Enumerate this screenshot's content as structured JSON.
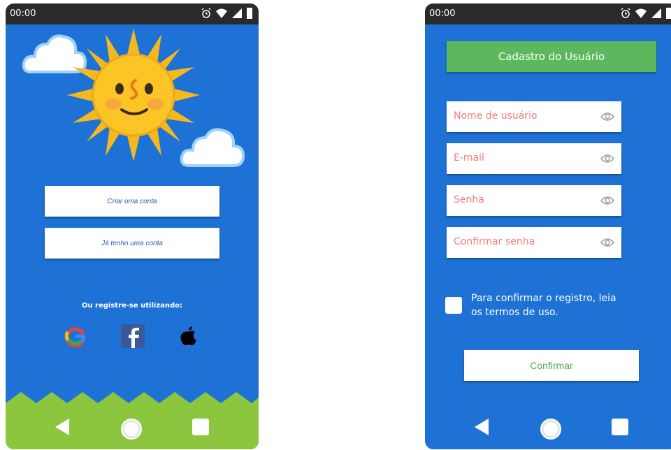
{
  "left_screen": {
    "status_time": "00:00",
    "create_account_label": "Criar uma conta",
    "have_account_label": "Já tenho uma conta",
    "register_with_label": "Ou registre-se utilizando:",
    "social_icons": [
      "google-icon",
      "facebook-icon",
      "apple-icon"
    ],
    "background_color": "#1e72d6",
    "grass_color": "#8cc63f"
  },
  "right_screen": {
    "status_time": "00:00",
    "header_label": "Cadastro do Usuário",
    "fields": [
      {
        "placeholder": "Nome de usuário",
        "icon": "eye-icon"
      },
      {
        "placeholder": "E-mail",
        "icon": "eye-icon"
      },
      {
        "placeholder": "Senha",
        "icon": "eye-icon"
      },
      {
        "placeholder": "Confirmar senha",
        "icon": "eye-icon"
      }
    ],
    "terms_line1": "Para confirmar o registro, leia",
    "terms_line2": "os termos de uso.",
    "confirm_label": "Confirmar",
    "accent_color": "#5cb85c",
    "placeholder_color": "#f27d7d"
  }
}
